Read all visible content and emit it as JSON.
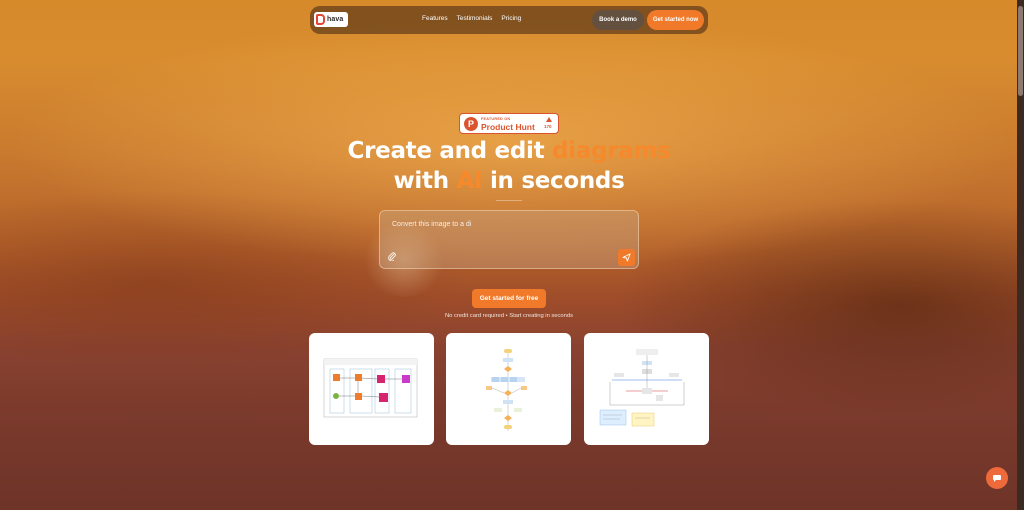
{
  "nav": {
    "logo_text": "hava",
    "links": [
      "Features",
      "Testimonials",
      "Pricing"
    ],
    "book_demo": "Book a demo",
    "get_started": "Get started now"
  },
  "badge": {
    "small": "FEATURED ON",
    "big": "Product Hunt",
    "count": "170"
  },
  "hero": {
    "line1_pre": "Create and edit ",
    "line1_accent": "diagrams",
    "line2_pre": "with ",
    "line2_accent": "AI",
    "line2_post": " in seconds"
  },
  "prompt": {
    "text": "Convert this image to a di"
  },
  "cta": {
    "label": "Get started for free",
    "note": "No credit card required • Start creating in seconds"
  },
  "cards": [
    "aws-architecture-diagram",
    "flowchart-diagram",
    "network-diagram"
  ],
  "colors": {
    "accent": "#f07a2a",
    "producthunt": "#da552f"
  },
  "icons": [
    "paperclip-icon",
    "send-icon",
    "chat-icon",
    "logo-icon",
    "producthunt-icon",
    "upvote-arrow-icon"
  ]
}
